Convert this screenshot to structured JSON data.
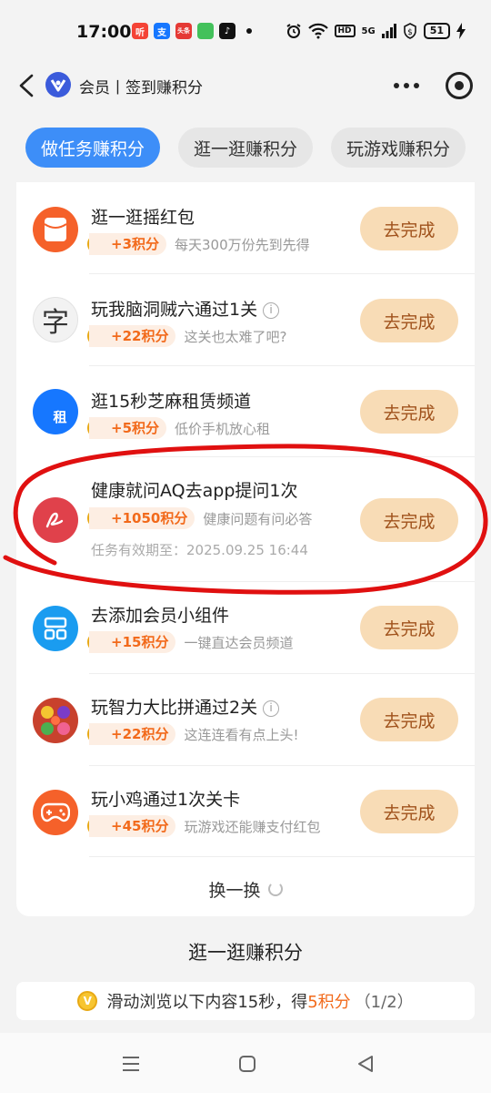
{
  "status_bar": {
    "time": "17:00",
    "notif_icons": [
      {
        "name": "app-icon-red",
        "label": "听",
        "color": "#f44336"
      },
      {
        "name": "alipay-icon",
        "label": "支",
        "color": "#1677ff"
      },
      {
        "name": "toutiao-icon",
        "label": "头条",
        "color": "#e53935"
      },
      {
        "name": "message-icon",
        "label": "",
        "color": "#43c15b"
      },
      {
        "name": "tiktok-icon",
        "label": "♪",
        "color": "#111111"
      }
    ],
    "network": "5G",
    "battery": "51"
  },
  "header": {
    "title": "会员丨签到赚积分"
  },
  "tabs": [
    {
      "label": "做任务赚积分",
      "active": true
    },
    {
      "label": "逛一逛赚积分",
      "active": false
    },
    {
      "label": "玩游戏赚积分",
      "active": false
    }
  ],
  "tasks": [
    {
      "title": "逛一逛摇红包",
      "has_info": false,
      "points": "+3积分",
      "desc": "每天300万份先到先得",
      "button": "去完成",
      "icon": "red-envelope-icon",
      "icon_color": "#f5612a"
    },
    {
      "title": "玩我脑洞贼六通过1关",
      "has_info": true,
      "points": "+22积分",
      "desc": "这关也太难了吧?",
      "button": "去完成",
      "icon": "word-puzzle-icon",
      "icon_text": "字",
      "icon_color": "#f2f2f2"
    },
    {
      "title": "逛15秒芝麻租赁频道",
      "has_info": false,
      "points": "+5积分",
      "desc": "低价手机放心租",
      "button": "去完成",
      "icon": "zhima-rent-icon",
      "icon_text": "租",
      "icon_color": "#1677ff"
    },
    {
      "title": "健康就问AQ去app提问1次",
      "has_info": false,
      "points": "+1050积分",
      "desc": "健康问题有问必答",
      "expiry": "任务有效期至：2025.09.25 16:44",
      "button": "去完成",
      "icon": "health-aq-icon",
      "icon_color": "#e0414b"
    },
    {
      "title": "去添加会员小组件",
      "has_info": false,
      "points": "+15积分",
      "desc": "一键直达会员频道",
      "button": "去完成",
      "icon": "widget-icon",
      "icon_color": "#1a9cf0"
    },
    {
      "title": "玩智力大比拼通过2关",
      "has_info": true,
      "points": "+22积分",
      "desc": "这连连看有点上头!",
      "button": "去完成",
      "icon": "fruit-match-icon",
      "icon_color": "#d9422b"
    },
    {
      "title": "玩小鸡通过1次关卡",
      "has_info": false,
      "points": "+45积分",
      "desc": "玩游戏还能赚支付红包",
      "button": "去完成",
      "icon": "game-controller-icon",
      "icon_color": "#f5612a"
    }
  ],
  "refresh_label": "换一换",
  "section": {
    "title": "逛一逛赚积分",
    "browse_prefix": "滑动浏览以下内容15秒，得",
    "browse_points": "5积分",
    "browse_progress": "（1/2）"
  },
  "annotation_color": "#e01010"
}
